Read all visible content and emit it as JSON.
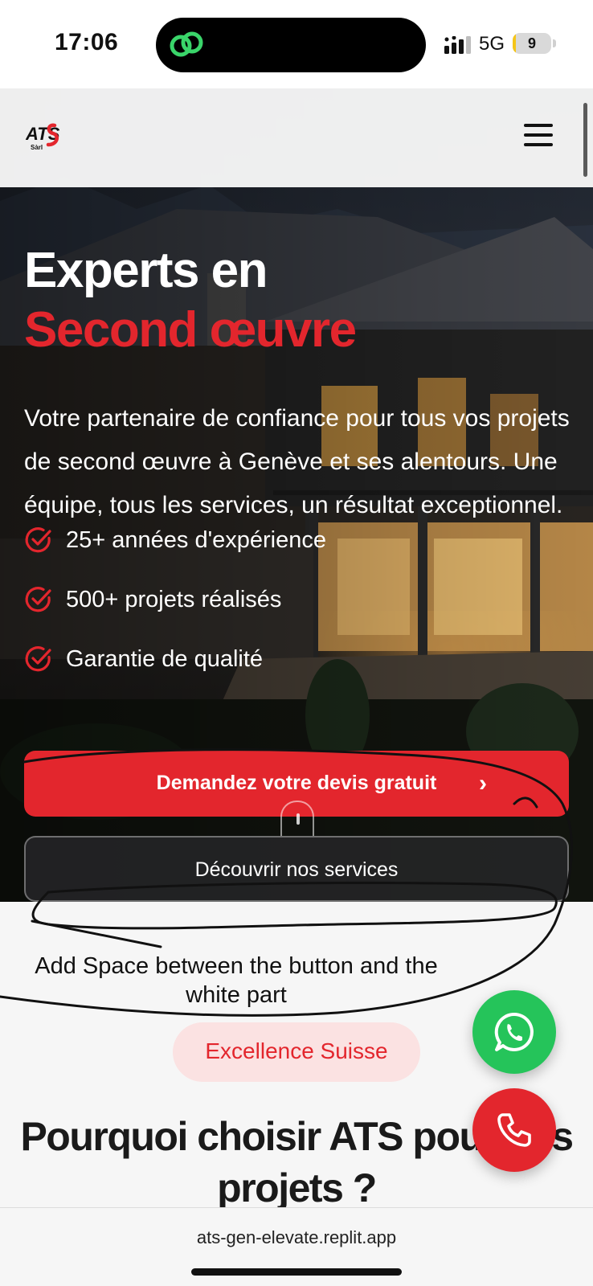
{
  "status_bar": {
    "time": "17:06",
    "network": "5G",
    "battery_level": "9",
    "battery_fraction": 0.09
  },
  "site_header": {
    "logo_text": "ATS",
    "logo_subtext": "Sàrl"
  },
  "hero": {
    "title_line1": "Experts en",
    "title_line2": "Second œuvre",
    "description": "Votre partenaire de confiance pour tous vos projets de second œuvre à Genève et ses alentours. Une équipe, tous les services, un résultat exceptionnel.",
    "features": [
      {
        "label": "25+ années d'expérience"
      },
      {
        "label": "500+ projets réalisés"
      },
      {
        "label": "Garantie de qualité"
      }
    ],
    "cta_primary": "Demandez votre devis gratuit",
    "cta_secondary": "Découvrir nos services"
  },
  "annotation": {
    "text": "Add Space between the button and the white part"
  },
  "section": {
    "badge": "Excellence Suisse",
    "title": "Pourquoi choisir ATS pour vos projets ?"
  },
  "browser": {
    "url": "ats-gen-elevate.replit.app"
  },
  "colors": {
    "accent": "#e3262d",
    "whatsapp": "#25c45a",
    "badge_bg": "#fbe2e2"
  },
  "icons": {
    "island_app": "link-icon",
    "feature": "check-circle-icon",
    "whatsapp": "whatsapp-icon",
    "phone": "phone-icon",
    "menu": "hamburger-icon"
  }
}
